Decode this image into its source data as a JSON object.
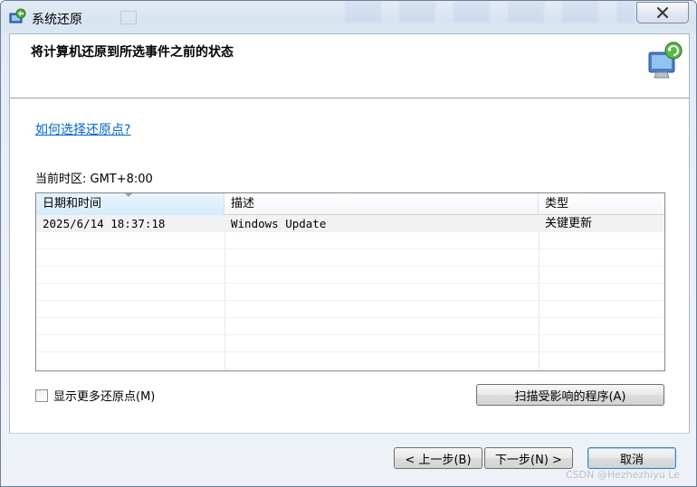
{
  "window": {
    "title": "系统还原",
    "close_label": "X"
  },
  "header": {
    "title": "将计算机还原到所选事件之前的状态"
  },
  "help_link": "如何选择还原点?",
  "timezone": "当前时区: GMT+8:00",
  "table": {
    "columns": [
      "日期和时间",
      "描述",
      "类型"
    ],
    "rows": [
      [
        "2025/6/14 18:37:18",
        "Windows Update",
        "关键更新"
      ]
    ]
  },
  "show_more_label": "显示更多还原点(M)",
  "scan_button": "扫描受影响的程序(A)",
  "footer": {
    "back": "< 上一步(B)",
    "next": "下一步(N) >",
    "cancel": "取消"
  },
  "watermark": "CSDN @Hezhezhiyu Le",
  "colors": {
    "link": "#0066cc",
    "frame": "#dfe9f5"
  }
}
